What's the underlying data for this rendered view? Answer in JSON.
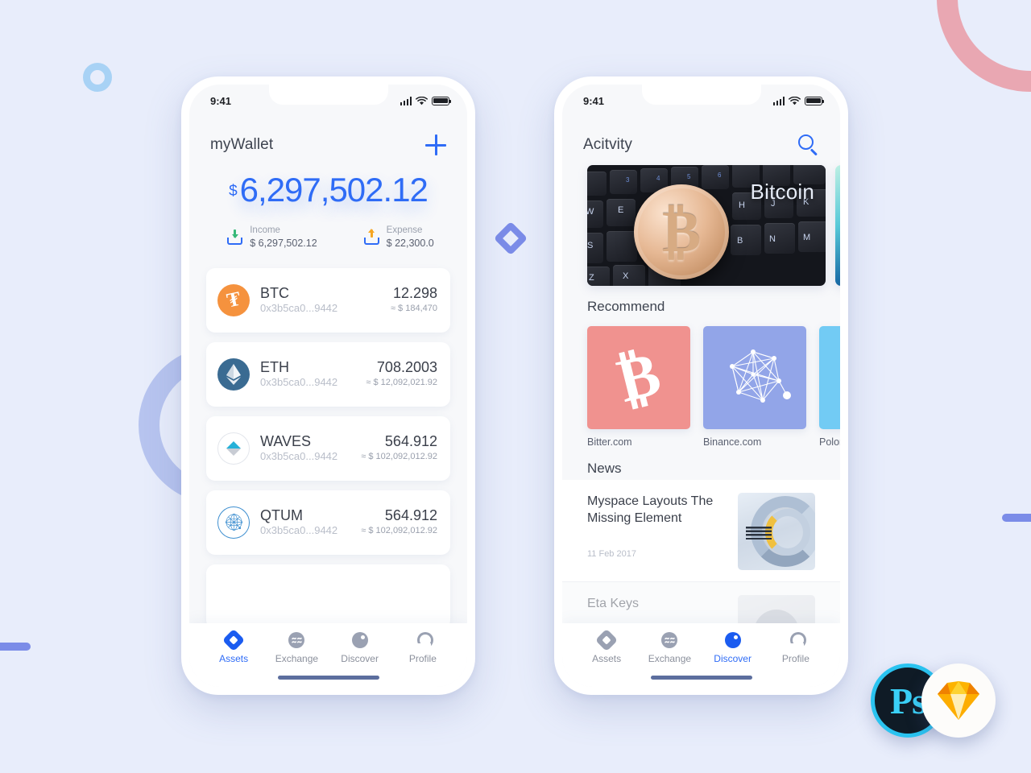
{
  "meta": {
    "background_color": "#e8edfb",
    "accent_color": "#2f6cf6",
    "periwinkle": "#7b8ce8",
    "pink": "#e9a7b2"
  },
  "wallet_screen": {
    "status_bar": {
      "time": "9:41",
      "signal_icon": "cellular-bars-icon",
      "wifi_icon": "wifi-icon",
      "battery_icon": "battery-icon"
    },
    "header": {
      "title": "myWallet",
      "add_icon": "plus-icon"
    },
    "balance": {
      "currency_symbol": "$",
      "amount": "6,297,502.12"
    },
    "summary": [
      {
        "icon": "income-arrow-down-icon",
        "label": "Income",
        "value": "$ 6,297,502.12"
      },
      {
        "icon": "expense-arrow-up-icon",
        "label": "Expense",
        "value": "$ 22,300.0"
      }
    ],
    "assets": [
      {
        "icon": "btc-coin-icon",
        "name": "BTC",
        "address": "0x3b5ca0...9442",
        "amount": "12.298",
        "usd": "≈ $ 184,470"
      },
      {
        "icon": "eth-coin-icon",
        "name": "ETH",
        "address": "0x3b5ca0...9442",
        "amount": "708.2003",
        "usd": "≈ $ 12,092,021.92"
      },
      {
        "icon": "waves-coin-icon",
        "name": "WAVES",
        "address": "0x3b5ca0...9442",
        "amount": "564.912",
        "usd": "≈ $ 102,092,012.92"
      },
      {
        "icon": "qtum-coin-icon",
        "name": "QTUM",
        "address": "0x3b5ca0...9442",
        "amount": "564.912",
        "usd": "≈ $ 102,092,012.92"
      }
    ],
    "tabs": [
      {
        "icon": "assets-diamond-icon",
        "label": "Assets",
        "active": true
      },
      {
        "icon": "exchange-wave-icon",
        "label": "Exchange",
        "active": false
      },
      {
        "icon": "discover-compass-icon",
        "label": "Discover",
        "active": false
      },
      {
        "icon": "profile-person-icon",
        "label": "Profile",
        "active": false
      }
    ]
  },
  "discover_screen": {
    "status_bar": {
      "time": "9:41",
      "signal_icon": "cellular-bars-icon",
      "wifi_icon": "wifi-icon",
      "battery_icon": "battery-icon"
    },
    "header": {
      "title": "Acitvity",
      "search_icon": "search-icon"
    },
    "banners": [
      {
        "caption": "Bitcoin",
        "image": "bitcoin-coin-on-keyboard-photo"
      },
      {
        "caption": "",
        "image": "teal-abstract-photo"
      }
    ],
    "recommend": {
      "title": "Recommend",
      "items": [
        {
          "caption": "Bitter.com",
          "icon": "bitcoin-b-icon",
          "color": "#f0928f"
        },
        {
          "caption": "Binance.com",
          "icon": "network-graph-icon",
          "color": "#92a5e8"
        },
        {
          "caption": "Polone",
          "icon": "poloniex-icon",
          "color": "#72cbf4"
        }
      ]
    },
    "news": {
      "title": "News",
      "items": [
        {
          "title": "Myspace Layouts The Missing Element",
          "date": "11 Feb 2017",
          "thumb": "ibm-server-coil-photo"
        },
        {
          "title": "Eta Keys",
          "date": "",
          "thumb": "person-avatar-photo"
        }
      ]
    },
    "tabs": [
      {
        "icon": "assets-diamond-icon",
        "label": "Assets",
        "active": false
      },
      {
        "icon": "exchange-wave-icon",
        "label": "Exchange",
        "active": false
      },
      {
        "icon": "discover-compass-icon",
        "label": "Discover",
        "active": true
      },
      {
        "icon": "profile-person-icon",
        "label": "Profile",
        "active": false
      }
    ]
  },
  "badges": [
    {
      "name": "photoshop-badge",
      "label": "Ps"
    },
    {
      "name": "sketch-badge",
      "label": ""
    }
  ]
}
